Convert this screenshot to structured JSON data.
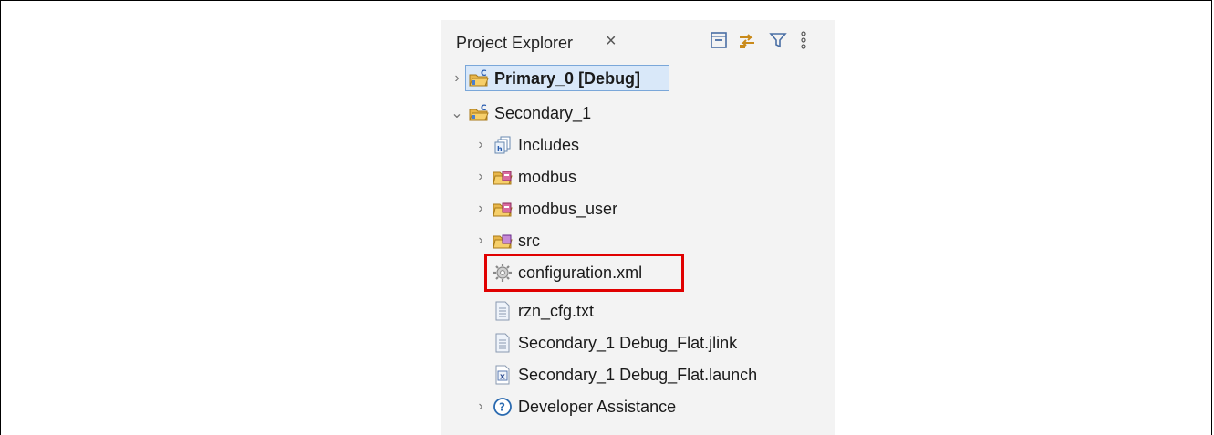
{
  "tab": {
    "title": "Project Explorer",
    "close_glyph": "×"
  },
  "toolbar": [
    {
      "name": "collapse-all-icon"
    },
    {
      "name": "link-with-editor-icon"
    },
    {
      "name": "filter-icon"
    },
    {
      "name": "view-menu-icon"
    }
  ],
  "tree": {
    "primary": {
      "label": "Primary_0 [Debug]",
      "icon": "c-project-icon"
    },
    "secondary": {
      "label": "Secondary_1",
      "icon": "c-project-icon"
    },
    "includes": {
      "label": "Includes",
      "icon": "includes-icon"
    },
    "modbus": {
      "label": "modbus",
      "icon": "source-folder-icon"
    },
    "modbus_user": {
      "label": "modbus_user",
      "icon": "source-folder-icon"
    },
    "src": {
      "label": "src",
      "icon": "source-folder-icon"
    },
    "configuration": {
      "label": "configuration.xml",
      "icon": "gear-file-icon"
    },
    "rzn_cfg": {
      "label": "rzn_cfg.txt",
      "icon": "text-file-icon"
    },
    "jlink": {
      "label": "Secondary_1 Debug_Flat.jlink",
      "icon": "text-file-icon"
    },
    "launch": {
      "label": "Secondary_1 Debug_Flat.launch",
      "icon": "launch-file-icon"
    },
    "dev_assist": {
      "label": "Developer Assistance",
      "icon": "help-icon"
    }
  },
  "colors": {
    "highlight": "#e00000",
    "selection": "#d9e8f9"
  }
}
